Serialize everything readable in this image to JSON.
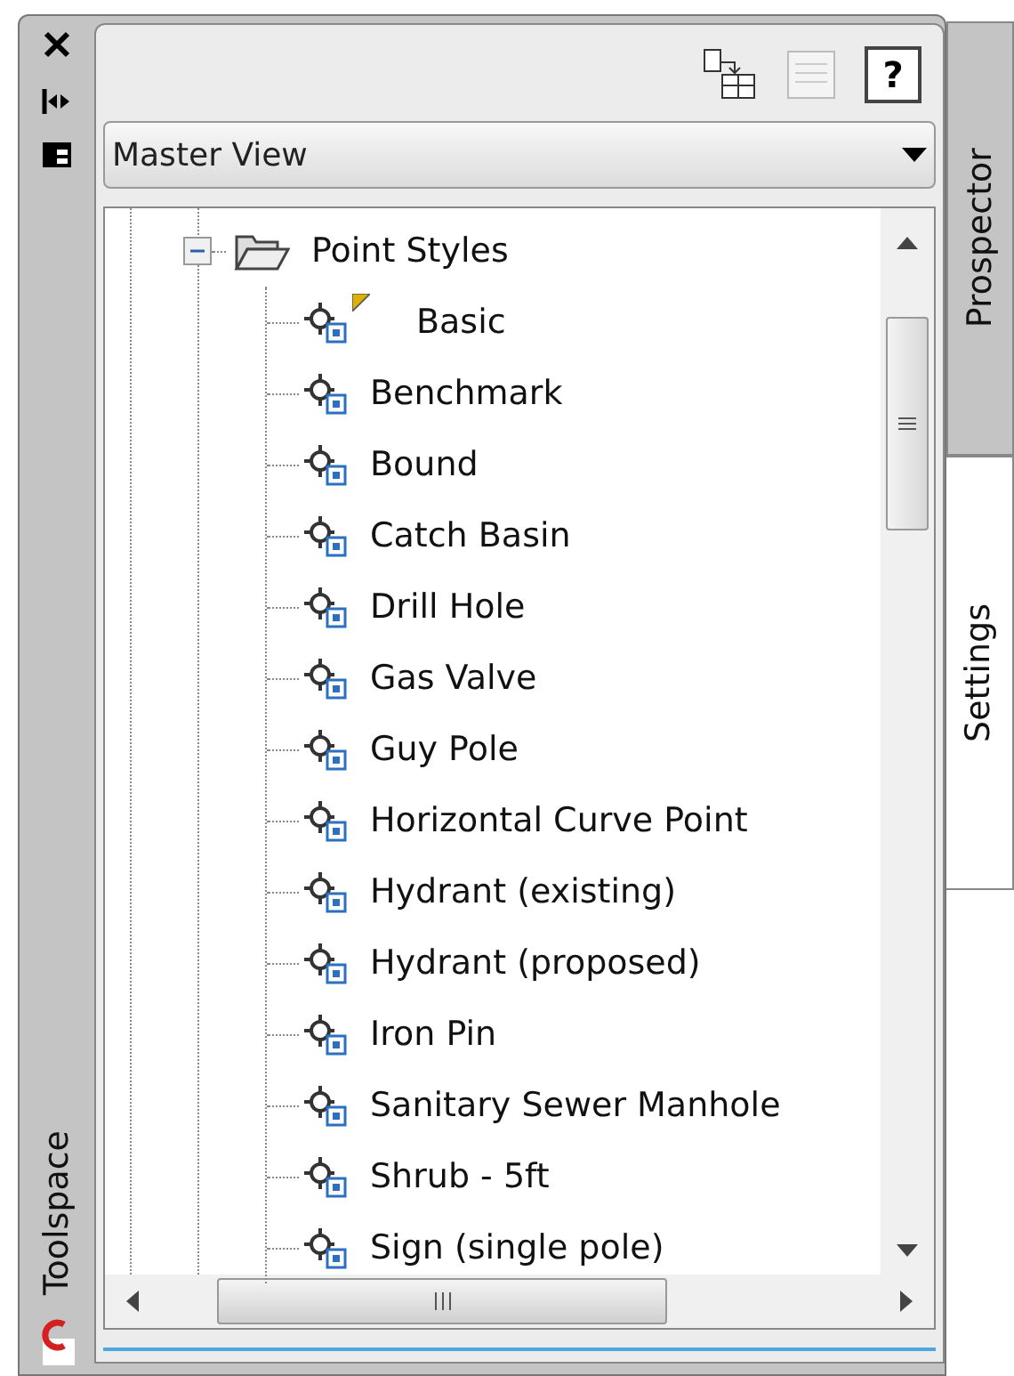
{
  "toolspace": {
    "title": "Toolspace"
  },
  "toolbar": {
    "help_label": "?"
  },
  "view_select": {
    "value": "Master View"
  },
  "tree": [
    {
      "label": "Point Styles",
      "expanded": true,
      "children": [
        {
          "label": "Basic",
          "flagged": true
        },
        {
          "label": "Benchmark",
          "flagged": false
        },
        {
          "label": "Bound",
          "flagged": false
        },
        {
          "label": "Catch Basin",
          "flagged": false
        },
        {
          "label": "Drill Hole",
          "flagged": false
        },
        {
          "label": "Gas Valve",
          "flagged": false
        },
        {
          "label": "Guy Pole",
          "flagged": false
        },
        {
          "label": "Horizontal Curve Point",
          "flagged": false
        },
        {
          "label": "Hydrant (existing)",
          "flagged": false
        },
        {
          "label": "Hydrant (proposed)",
          "flagged": false
        },
        {
          "label": "Iron Pin",
          "flagged": false
        },
        {
          "label": "Sanitary Sewer Manhole",
          "flagged": false
        },
        {
          "label": "Shrub - 5ft",
          "flagged": false
        },
        {
          "label": "Sign (single pole)",
          "flagged": false
        }
      ]
    }
  ],
  "tabs": [
    {
      "label": "Prospector",
      "selected": false
    },
    {
      "label": "Settings",
      "selected": true
    }
  ]
}
